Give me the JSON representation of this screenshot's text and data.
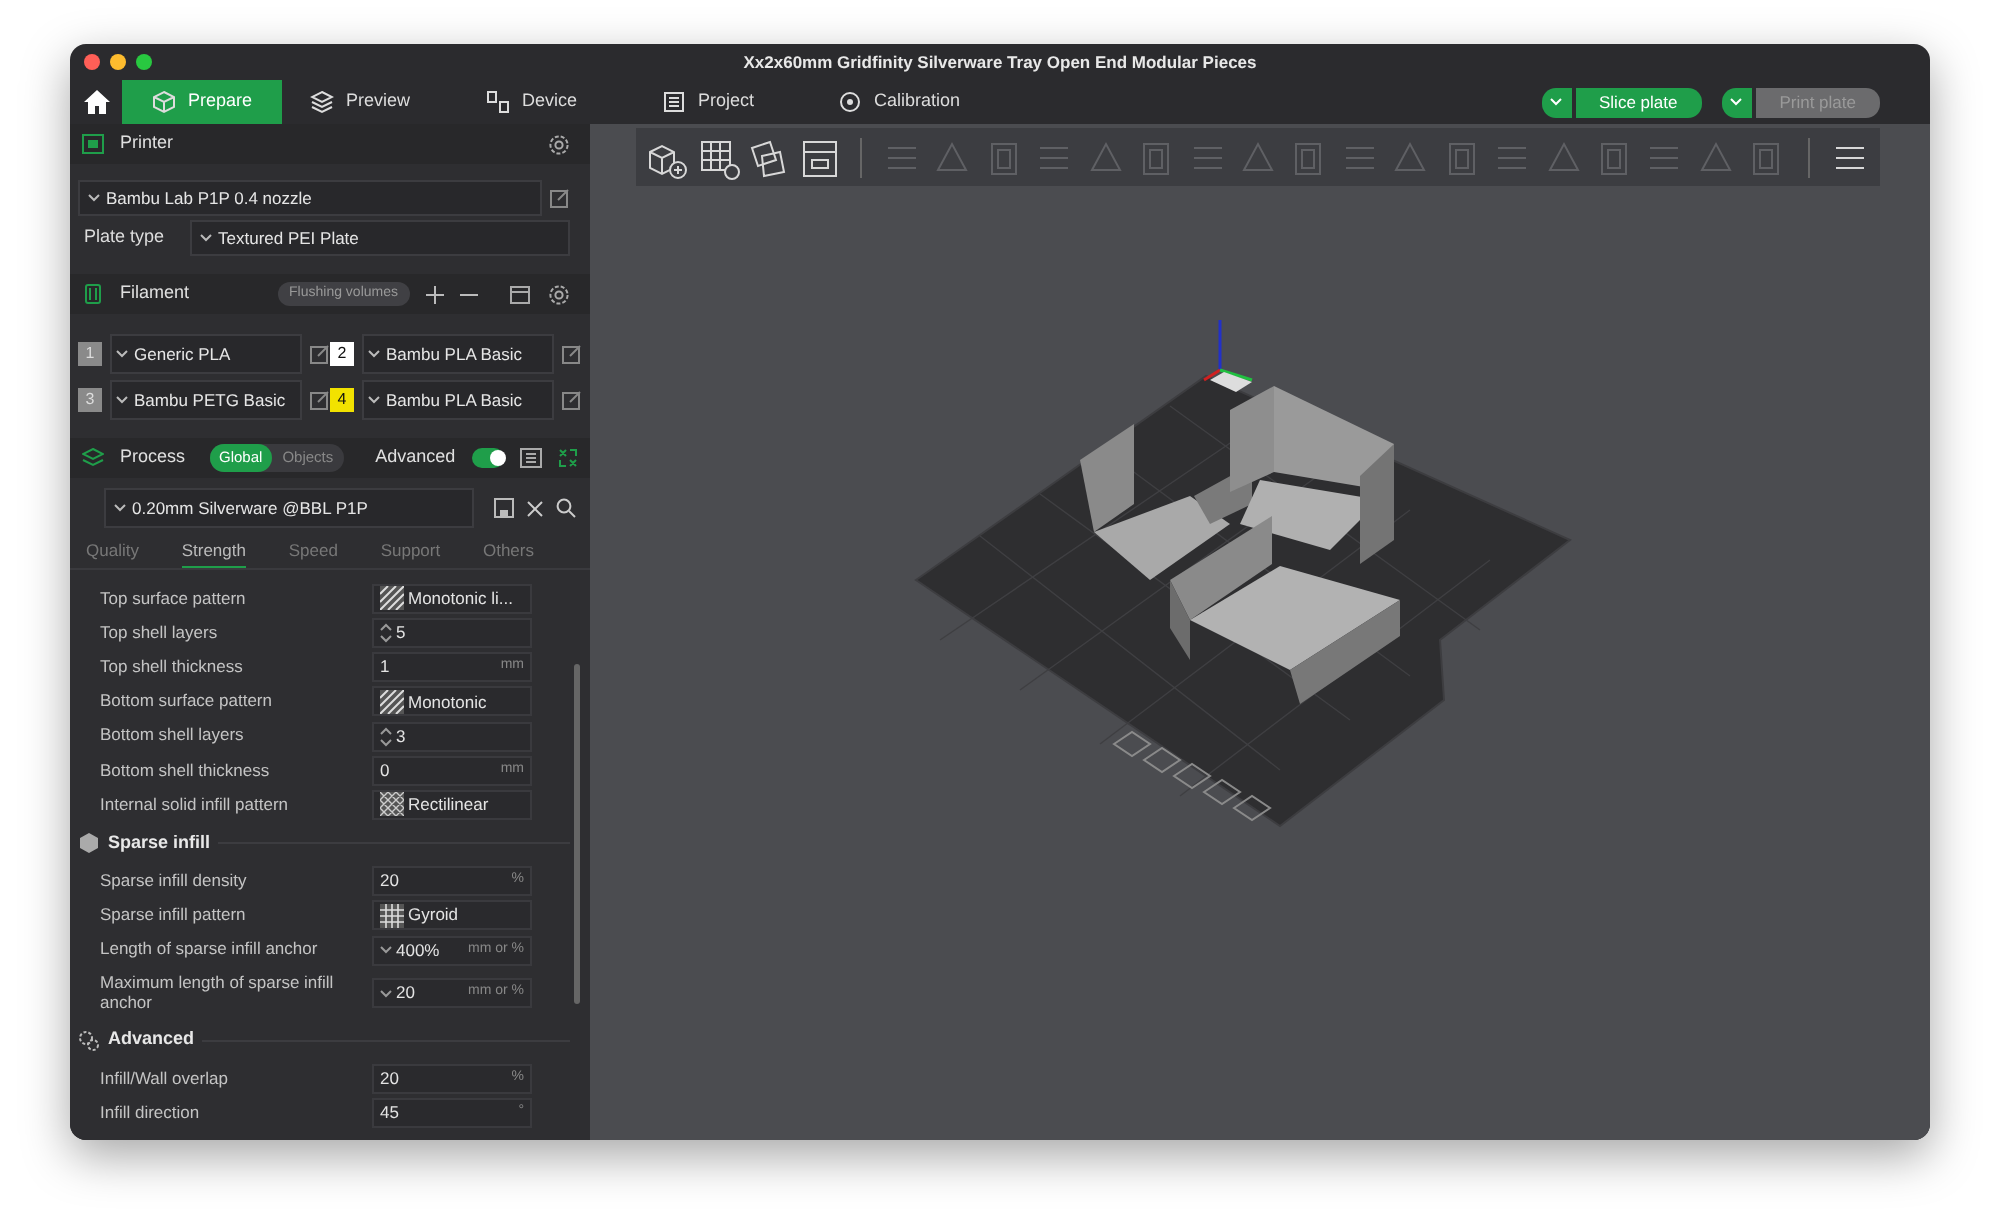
{
  "window": {
    "title": "Xx2x60mm Gridfinity Silverware Tray Open End Modular Pieces"
  },
  "tabs": [
    {
      "label": "Prepare",
      "selected": true
    },
    {
      "label": "Preview",
      "selected": false
    },
    {
      "label": "Device",
      "selected": false
    },
    {
      "label": "Project",
      "selected": false
    },
    {
      "label": "Calibration",
      "selected": false
    }
  ],
  "actions": [
    {
      "label": "Slice plate",
      "disabled": false
    },
    {
      "label": "Print plate",
      "disabled": true
    }
  ],
  "toolbar": [
    {
      "disabled": false
    },
    {
      "disabled": false
    },
    {
      "disabled": false
    },
    {
      "disabled": false
    },
    {
      "disabled": true
    },
    {
      "disabled": true
    },
    {
      "disabled": true
    },
    {
      "disabled": true
    },
    {
      "disabled": true
    },
    {
      "disabled": true
    },
    {
      "disabled": true
    },
    {
      "disabled": true
    },
    {
      "disabled": true
    },
    {
      "disabled": true
    },
    {
      "disabled": true
    },
    {
      "disabled": true
    },
    {
      "disabled": true
    },
    {
      "disabled": true
    },
    {
      "disabled": true
    },
    {
      "disabled": true
    },
    {
      "disabled": true
    },
    {
      "disabled": true
    },
    {
      "disabled": false
    }
  ],
  "printer": {
    "title": "Printer",
    "preset": "Bambu Lab P1P 0.4 nozzle",
    "plate_type_label": "Plate type",
    "plate_type": "Textured PEI Plate"
  },
  "filament": {
    "title": "Filament",
    "flushing_button": "Flushing volumes",
    "slots": [
      {
        "number": "1",
        "color": "#8a8a8a",
        "name": "Generic PLA"
      },
      {
        "number": "2",
        "color": "#ffffff",
        "name": "Bambu PLA Basic"
      },
      {
        "number": "3",
        "color": "#8a8a8a",
        "name": "Bambu PETG Basic"
      },
      {
        "number": "4",
        "color": "#f2e200",
        "name": "Bambu PLA Basic"
      }
    ]
  },
  "process": {
    "title": "Process",
    "scopes": [
      {
        "label": "Global",
        "selected": true
      },
      {
        "label": "Objects",
        "selected": false
      }
    ],
    "advanced_label": "Advanced",
    "advanced_on": true,
    "preset": "0.20mm Silverware @BBL P1P",
    "tabs": [
      {
        "label": "Quality",
        "selected": false
      },
      {
        "label": "Strength",
        "selected": true
      },
      {
        "label": "Speed",
        "selected": false
      },
      {
        "label": "Support",
        "selected": false
      },
      {
        "label": "Others",
        "selected": false
      }
    ],
    "settings": [
      {
        "kind": "pattern",
        "label": "Top surface pattern",
        "value": "Monotonic li..."
      },
      {
        "kind": "spin",
        "label": "Top shell layers",
        "value": "5"
      },
      {
        "kind": "unit",
        "label": "Top shell thickness",
        "value": "1",
        "unit": "mm"
      },
      {
        "kind": "pattern",
        "label": "Bottom surface pattern",
        "value": "Monotonic"
      },
      {
        "kind": "spin",
        "label": "Bottom shell layers",
        "value": "3"
      },
      {
        "kind": "unit",
        "label": "Bottom shell thickness",
        "value": "0",
        "unit": "mm"
      },
      {
        "kind": "pattern",
        "label": "Internal solid infill pattern",
        "value": "Rectilinear"
      },
      {
        "kind": "section",
        "label": "Sparse infill"
      },
      {
        "kind": "unit",
        "label": "Sparse infill density",
        "value": "20",
        "unit": "%"
      },
      {
        "kind": "pattern",
        "label": "Sparse infill pattern",
        "value": "Gyroid"
      },
      {
        "kind": "combo",
        "label": "Length of sparse infill anchor",
        "value": "400%",
        "unit": "mm or %"
      },
      {
        "kind": "combo",
        "label": "Maximum length of sparse infill anchor",
        "value": "20",
        "unit": "mm or %"
      },
      {
        "kind": "section",
        "label": "Advanced"
      },
      {
        "kind": "unit",
        "label": "Infill/Wall overlap",
        "value": "20",
        "unit": "%"
      },
      {
        "kind": "unit",
        "label": "Infill direction",
        "value": "45",
        "unit": "°"
      }
    ]
  }
}
